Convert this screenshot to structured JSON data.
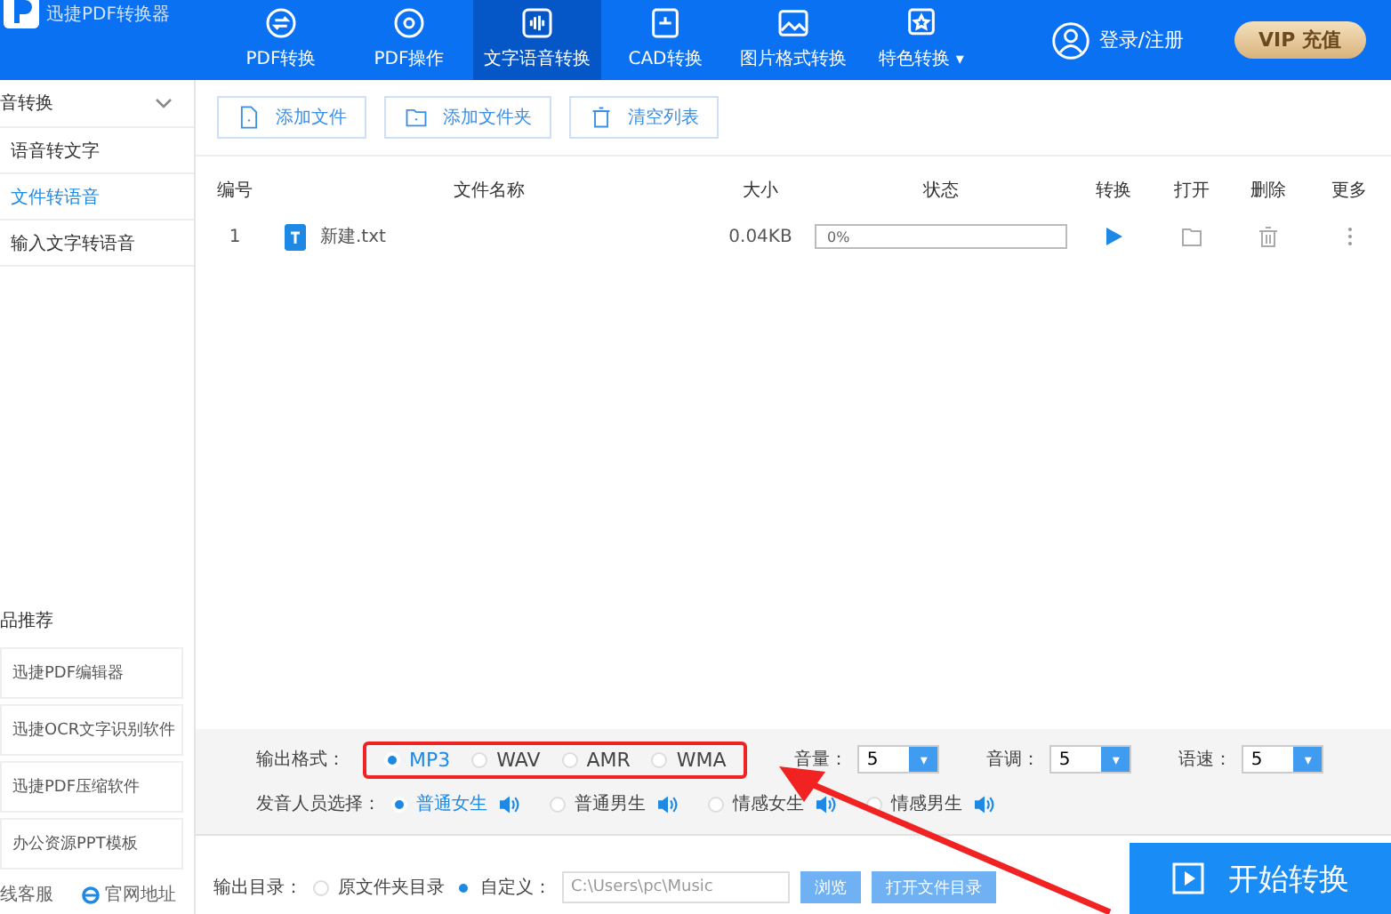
{
  "app": {
    "title": "迅捷PDF转换器"
  },
  "nav": [
    {
      "label": "PDF转换",
      "selected": false
    },
    {
      "label": "PDF操作",
      "selected": false
    },
    {
      "label": "文字语音转换",
      "selected": true
    },
    {
      "label": "CAD转换",
      "selected": false
    },
    {
      "label": "图片格式转换",
      "selected": false
    },
    {
      "label": "特色转换",
      "selected": false,
      "caret": "▾"
    }
  ],
  "account": {
    "login": "登录/注册",
    "vip": "VIP 充值"
  },
  "sidebar": {
    "sections": [
      {
        "title": "音转换",
        "items": [
          {
            "label": "语音转文字",
            "selected": false
          },
          {
            "label": "文件转语音",
            "selected": true
          },
          {
            "label": "输入文字转语音",
            "selected": false
          }
        ]
      }
    ],
    "products_title": "品推荐",
    "products": [
      "迅捷PDF编辑器",
      "迅捷OCR文字识别软件",
      "迅捷PDF压缩软件",
      "办公资源PPT模板"
    ],
    "footer": [
      "线客服",
      "官网地址"
    ]
  },
  "toolbar": [
    {
      "label": "添加文件"
    },
    {
      "label": "添加文件夹"
    },
    {
      "label": "清空列表"
    }
  ],
  "table": {
    "columns": [
      "编号",
      "文件名称",
      "大小",
      "状态",
      "转换",
      "打开",
      "删除",
      "更多"
    ],
    "rows": [
      {
        "index": "1",
        "name": "新建.txt",
        "size": "0.04KB",
        "progress": "0%",
        "level": 0
      }
    ]
  },
  "settings": {
    "format_label": "输出格式：",
    "formats": [
      {
        "label": "MP3",
        "selected": true
      },
      {
        "label": "WAV",
        "selected": false
      },
      {
        "label": "AMR",
        "selected": false
      },
      {
        "label": "WMA",
        "selected": false
      }
    ],
    "selects": [
      {
        "label": "音量：",
        "value": "5",
        "caret": "▾"
      },
      {
        "label": "音调：",
        "value": "5",
        "caret": "▾"
      },
      {
        "label": "语速：",
        "value": "5",
        "caret": "▾"
      }
    ],
    "voice_label": "发音人员选择：",
    "voices": [
      {
        "label": "普通女生",
        "selected": true
      },
      {
        "label": "普通男生",
        "selected": false
      },
      {
        "label": "情感女生",
        "selected": false
      },
      {
        "label": "情感男生",
        "selected": false
      }
    ]
  },
  "output": {
    "label": "输出目录：",
    "options": [
      {
        "label": "原文件夹目录",
        "selected": false
      },
      {
        "label": "自定义：",
        "selected": true
      }
    ],
    "path": "C:\\Users\\pc\\Music",
    "browse": "浏览",
    "open_dir": "打开文件目录",
    "start": "开始转换"
  }
}
